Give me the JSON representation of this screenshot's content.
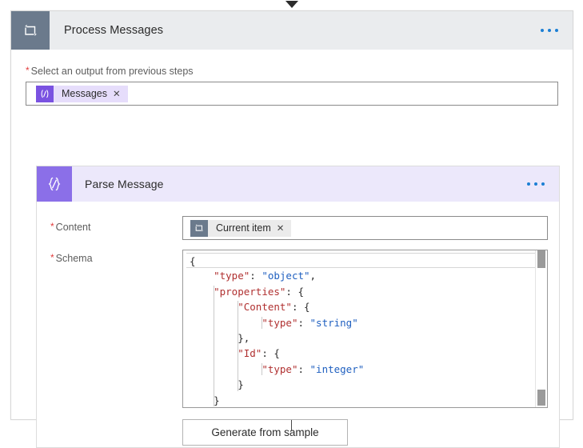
{
  "canvas": {
    "top_connector_icon": "chevron-down-arrowhead",
    "bottom_connector": "vertical-line"
  },
  "outer_card": {
    "icon": "loop-foreach-icon",
    "title": "Process Messages",
    "more_menu": "ellipsis-icon",
    "input_field": {
      "label": "Select an output from previous steps",
      "required": true,
      "required_marker": "*",
      "token": {
        "icon": "expression-code-icon",
        "icon_glyph": "⟨/⟩",
        "label": "Messages",
        "remove": "✕"
      }
    }
  },
  "inner_card": {
    "icon": "parse-json-icon",
    "icon_glyph": "{∅}",
    "title": "Parse Message",
    "more_menu": "ellipsis-icon",
    "content_field": {
      "label": "Content",
      "required": true,
      "required_marker": "*",
      "token": {
        "icon": "loop-current-item-icon",
        "label": "Current item",
        "remove": "✕"
      }
    },
    "schema_field": {
      "label": "Schema",
      "required": true,
      "required_marker": "*",
      "code_lines": [
        {
          "indent": 0,
          "tokens": [
            {
              "t": "{",
              "c": "p"
            }
          ]
        },
        {
          "indent": 1,
          "tokens": [
            {
              "t": "\"type\"",
              "c": "k"
            },
            {
              "t": ": ",
              "c": "p"
            },
            {
              "t": "\"object\"",
              "c": "s"
            },
            {
              "t": ",",
              "c": "p"
            }
          ]
        },
        {
          "indent": 1,
          "tokens": [
            {
              "t": "\"properties\"",
              "c": "k"
            },
            {
              "t": ": {",
              "c": "p"
            }
          ]
        },
        {
          "indent": 2,
          "tokens": [
            {
              "t": "\"Content\"",
              "c": "k"
            },
            {
              "t": ": {",
              "c": "p"
            }
          ]
        },
        {
          "indent": 3,
          "tokens": [
            {
              "t": "\"type\"",
              "c": "k"
            },
            {
              "t": ": ",
              "c": "p"
            },
            {
              "t": "\"string\"",
              "c": "s"
            }
          ]
        },
        {
          "indent": 2,
          "tokens": [
            {
              "t": "},",
              "c": "p"
            }
          ]
        },
        {
          "indent": 2,
          "tokens": [
            {
              "t": "\"Id\"",
              "c": "k"
            },
            {
              "t": ": {",
              "c": "p"
            }
          ]
        },
        {
          "indent": 3,
          "tokens": [
            {
              "t": "\"type\"",
              "c": "k"
            },
            {
              "t": ": ",
              "c": "p"
            },
            {
              "t": "\"integer\"",
              "c": "s"
            }
          ]
        },
        {
          "indent": 2,
          "tokens": [
            {
              "t": "}",
              "c": "p"
            }
          ]
        },
        {
          "indent": 1,
          "tokens": [
            {
              "t": "}",
              "c": "p"
            }
          ]
        }
      ],
      "raw_text": "{\n    \"type\": \"object\",\n    \"properties\": {\n        \"Content\": {\n            \"type\": \"string\"\n        },\n        \"Id\": {\n            \"type\": \"integer\"\n        }\n    }",
      "scrollbar": "vertical-scrollbar"
    },
    "generate_button": {
      "label": "Generate from sample"
    }
  },
  "colors": {
    "outer_header_bg": "#eaecee",
    "outer_icon_bg": "#6b7a8c",
    "inner_header_bg": "#ece8fb",
    "inner_icon_bg": "#8b6fe8",
    "token_purple_bg": "#e6ddfb",
    "token_purple_icon": "#7a52e1",
    "token_gray_bg": "#ebebeb",
    "token_gray_icon": "#6b7a8c",
    "required_star": "#e23c3c",
    "ellipsis_blue": "#1b7fd4",
    "json_key": "#b03030",
    "json_string": "#2060c0"
  }
}
